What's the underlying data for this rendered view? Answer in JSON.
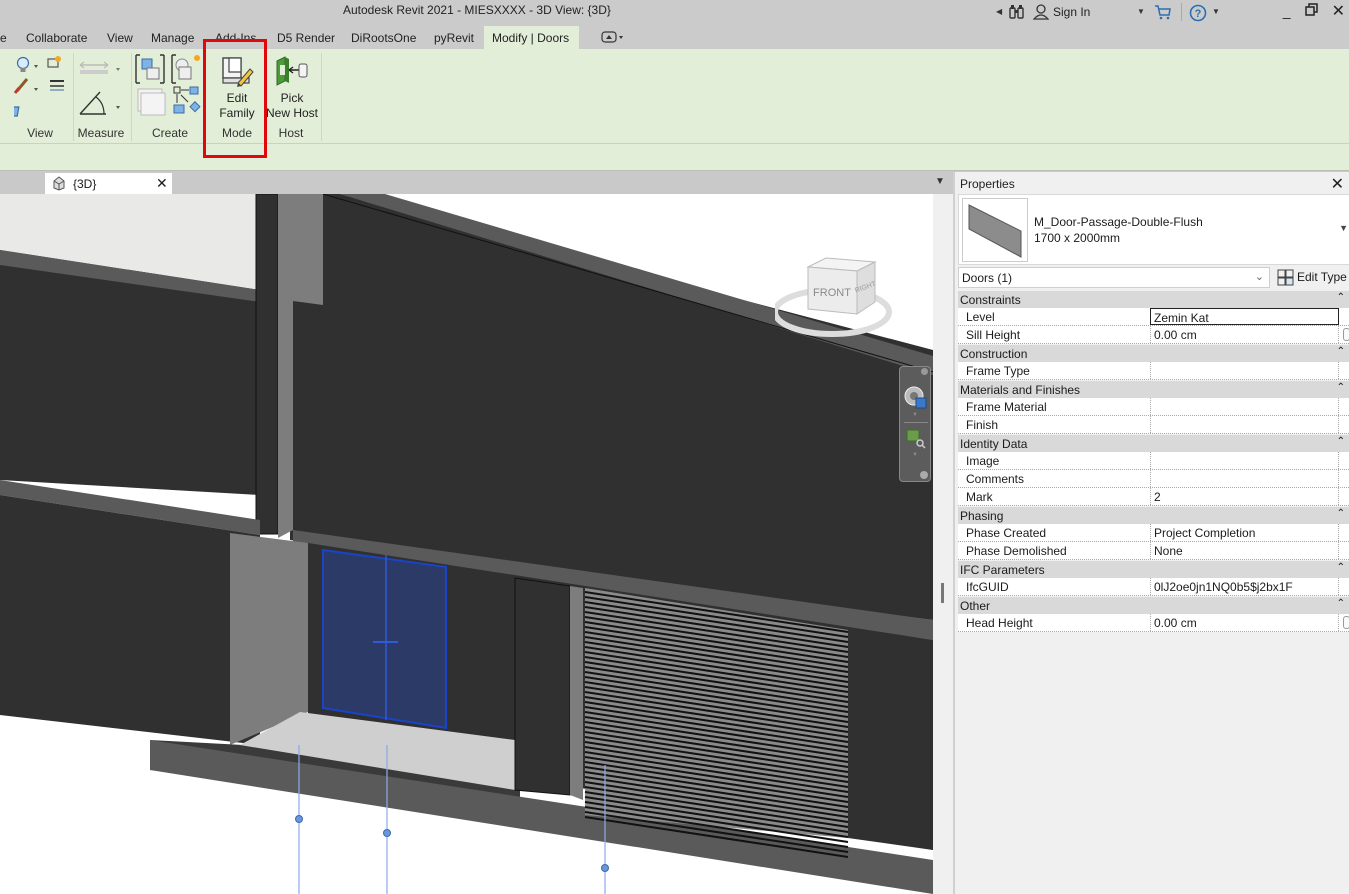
{
  "app": {
    "title": "Autodesk Revit 2021 - MIESXXXX - 3D View: {3D}",
    "sign_in": "Sign In"
  },
  "ribbon": {
    "tabs": [
      {
        "label": "e",
        "active": false
      },
      {
        "label": "Collaborate",
        "active": false
      },
      {
        "label": "View",
        "active": false
      },
      {
        "label": "Manage",
        "active": false
      },
      {
        "label": "Add-Ins",
        "active": false
      },
      {
        "label": "D5 Render",
        "active": false
      },
      {
        "label": "DiRootsOne",
        "active": false
      },
      {
        "label": "pyRevit",
        "active": false
      },
      {
        "label": "Modify | Doors",
        "active": true
      }
    ],
    "panels": {
      "view": "View",
      "measure": "Measure",
      "create": "Create",
      "mode": "Mode",
      "host": "Host"
    },
    "buttons": {
      "edit_family_line1": "Edit",
      "edit_family_line2": "Family",
      "pick_new_host_line1": "Pick",
      "pick_new_host_line2": "New Host"
    },
    "highlight_color": "#e0080b"
  },
  "view_tabs": [
    {
      "label": "{3D}",
      "icon": "3d-view-icon"
    }
  ],
  "viewcube": {
    "face_front": "FRONT",
    "face_right": "RIGHT"
  },
  "properties": {
    "title": "Properties",
    "type_name": "M_Door-Passage-Double-Flush",
    "type_size": "1700 x 2000mm",
    "filter": "Doors (1)",
    "edit_type": "Edit Type",
    "groups": [
      {
        "name": "Constraints",
        "rows": [
          {
            "name": "Level",
            "value": "Zemin Kat",
            "editing": true
          },
          {
            "name": "Sill Height",
            "value": "0.00 cm",
            "toggle": true
          }
        ]
      },
      {
        "name": "Construction",
        "rows": [
          {
            "name": "Frame Type",
            "value": ""
          }
        ]
      },
      {
        "name": "Materials and Finishes",
        "rows": [
          {
            "name": "Frame Material",
            "value": ""
          },
          {
            "name": "Finish",
            "value": ""
          }
        ]
      },
      {
        "name": "Identity Data",
        "rows": [
          {
            "name": "Image",
            "value": ""
          },
          {
            "name": "Comments",
            "value": ""
          },
          {
            "name": "Mark",
            "value": "2"
          }
        ]
      },
      {
        "name": "Phasing",
        "rows": [
          {
            "name": "Phase Created",
            "value": "Project Completion"
          },
          {
            "name": "Phase Demolished",
            "value": "None"
          }
        ]
      },
      {
        "name": "IFC Parameters",
        "rows": [
          {
            "name": "IfcGUID",
            "value": "0lJ2oe0jn1NQ0b5$j2bx1F"
          }
        ]
      },
      {
        "name": "Other",
        "rows": [
          {
            "name": "Head Height",
            "value": "0.00 cm",
            "toggle": true
          }
        ]
      }
    ]
  },
  "colors": {
    "ribbon_bg": "#e3eed8",
    "selection_blue": "#1a44c8",
    "wall_dark": "#303030"
  }
}
